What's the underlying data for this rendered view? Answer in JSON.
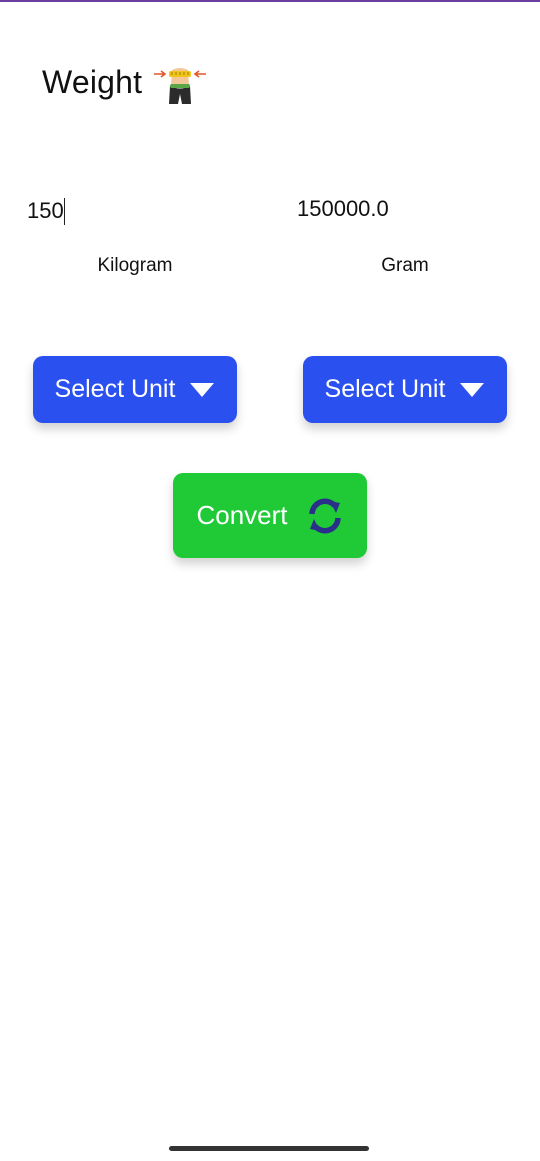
{
  "header": {
    "title": "Weight",
    "icon": "weight-loss-icon"
  },
  "converter": {
    "input_value": "150",
    "output_value": "150000.0",
    "from_unit": "Kilogram",
    "to_unit": "Gram",
    "from_select_label": "Select Unit",
    "to_select_label": "Select Unit",
    "convert_label": "Convert"
  },
  "colors": {
    "select_button": "#2a50f0",
    "convert_button": "#1fca36",
    "refresh_icon": "#2a2f8a"
  }
}
